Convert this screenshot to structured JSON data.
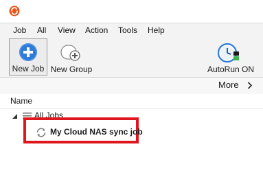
{
  "menubar": {
    "items": [
      "Job",
      "All",
      "View",
      "Action",
      "Tools",
      "Help"
    ]
  },
  "toolbar": {
    "new_job_label": "New Job",
    "new_group_label": "New Group",
    "autorun_label": "AutoRun ON"
  },
  "more": {
    "label": "More"
  },
  "list_header": {
    "name_label": "Name"
  },
  "tree": {
    "group_label": "All Jobs",
    "job_label": "My Cloud NAS sync job"
  },
  "icons": {
    "app": "app-logo-icon",
    "new_job": "plus-circle-icon",
    "new_group": "add-group-icon",
    "autorun": "clock-status-icon",
    "more_chevron": "chevron-right-icon",
    "group_expand": "triangle-expand-icon",
    "group_icon": "list-lines-icon",
    "job_icon": "sync-icon"
  },
  "colors": {
    "accent_blue": "#2f7bd9",
    "highlight_red": "#e0161e",
    "brand_orange": "#e8541a",
    "status_green": "#3fb34f"
  }
}
